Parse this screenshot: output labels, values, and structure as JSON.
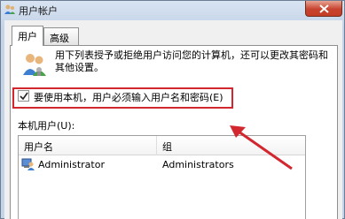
{
  "window": {
    "title": "用户帐户",
    "close_icon": "close-icon"
  },
  "tabs": [
    {
      "label": "用户"
    },
    {
      "label": "高级"
    }
  ],
  "description": "用下列表授予或拒绝用户访问您的计算机，还可以更改其密码和其他设置。",
  "checkbox": {
    "label": "要使用本机，用户必须输入用户名和密码(E)",
    "checked": true
  },
  "local_users_label": "本机用户(U):",
  "table": {
    "columns": [
      "用户名",
      "组"
    ],
    "rows": [
      {
        "name": "Administrator",
        "group": "Administrators"
      }
    ]
  },
  "colors": {
    "highlight": "#d3272f",
    "arrow": "#d3272f"
  }
}
